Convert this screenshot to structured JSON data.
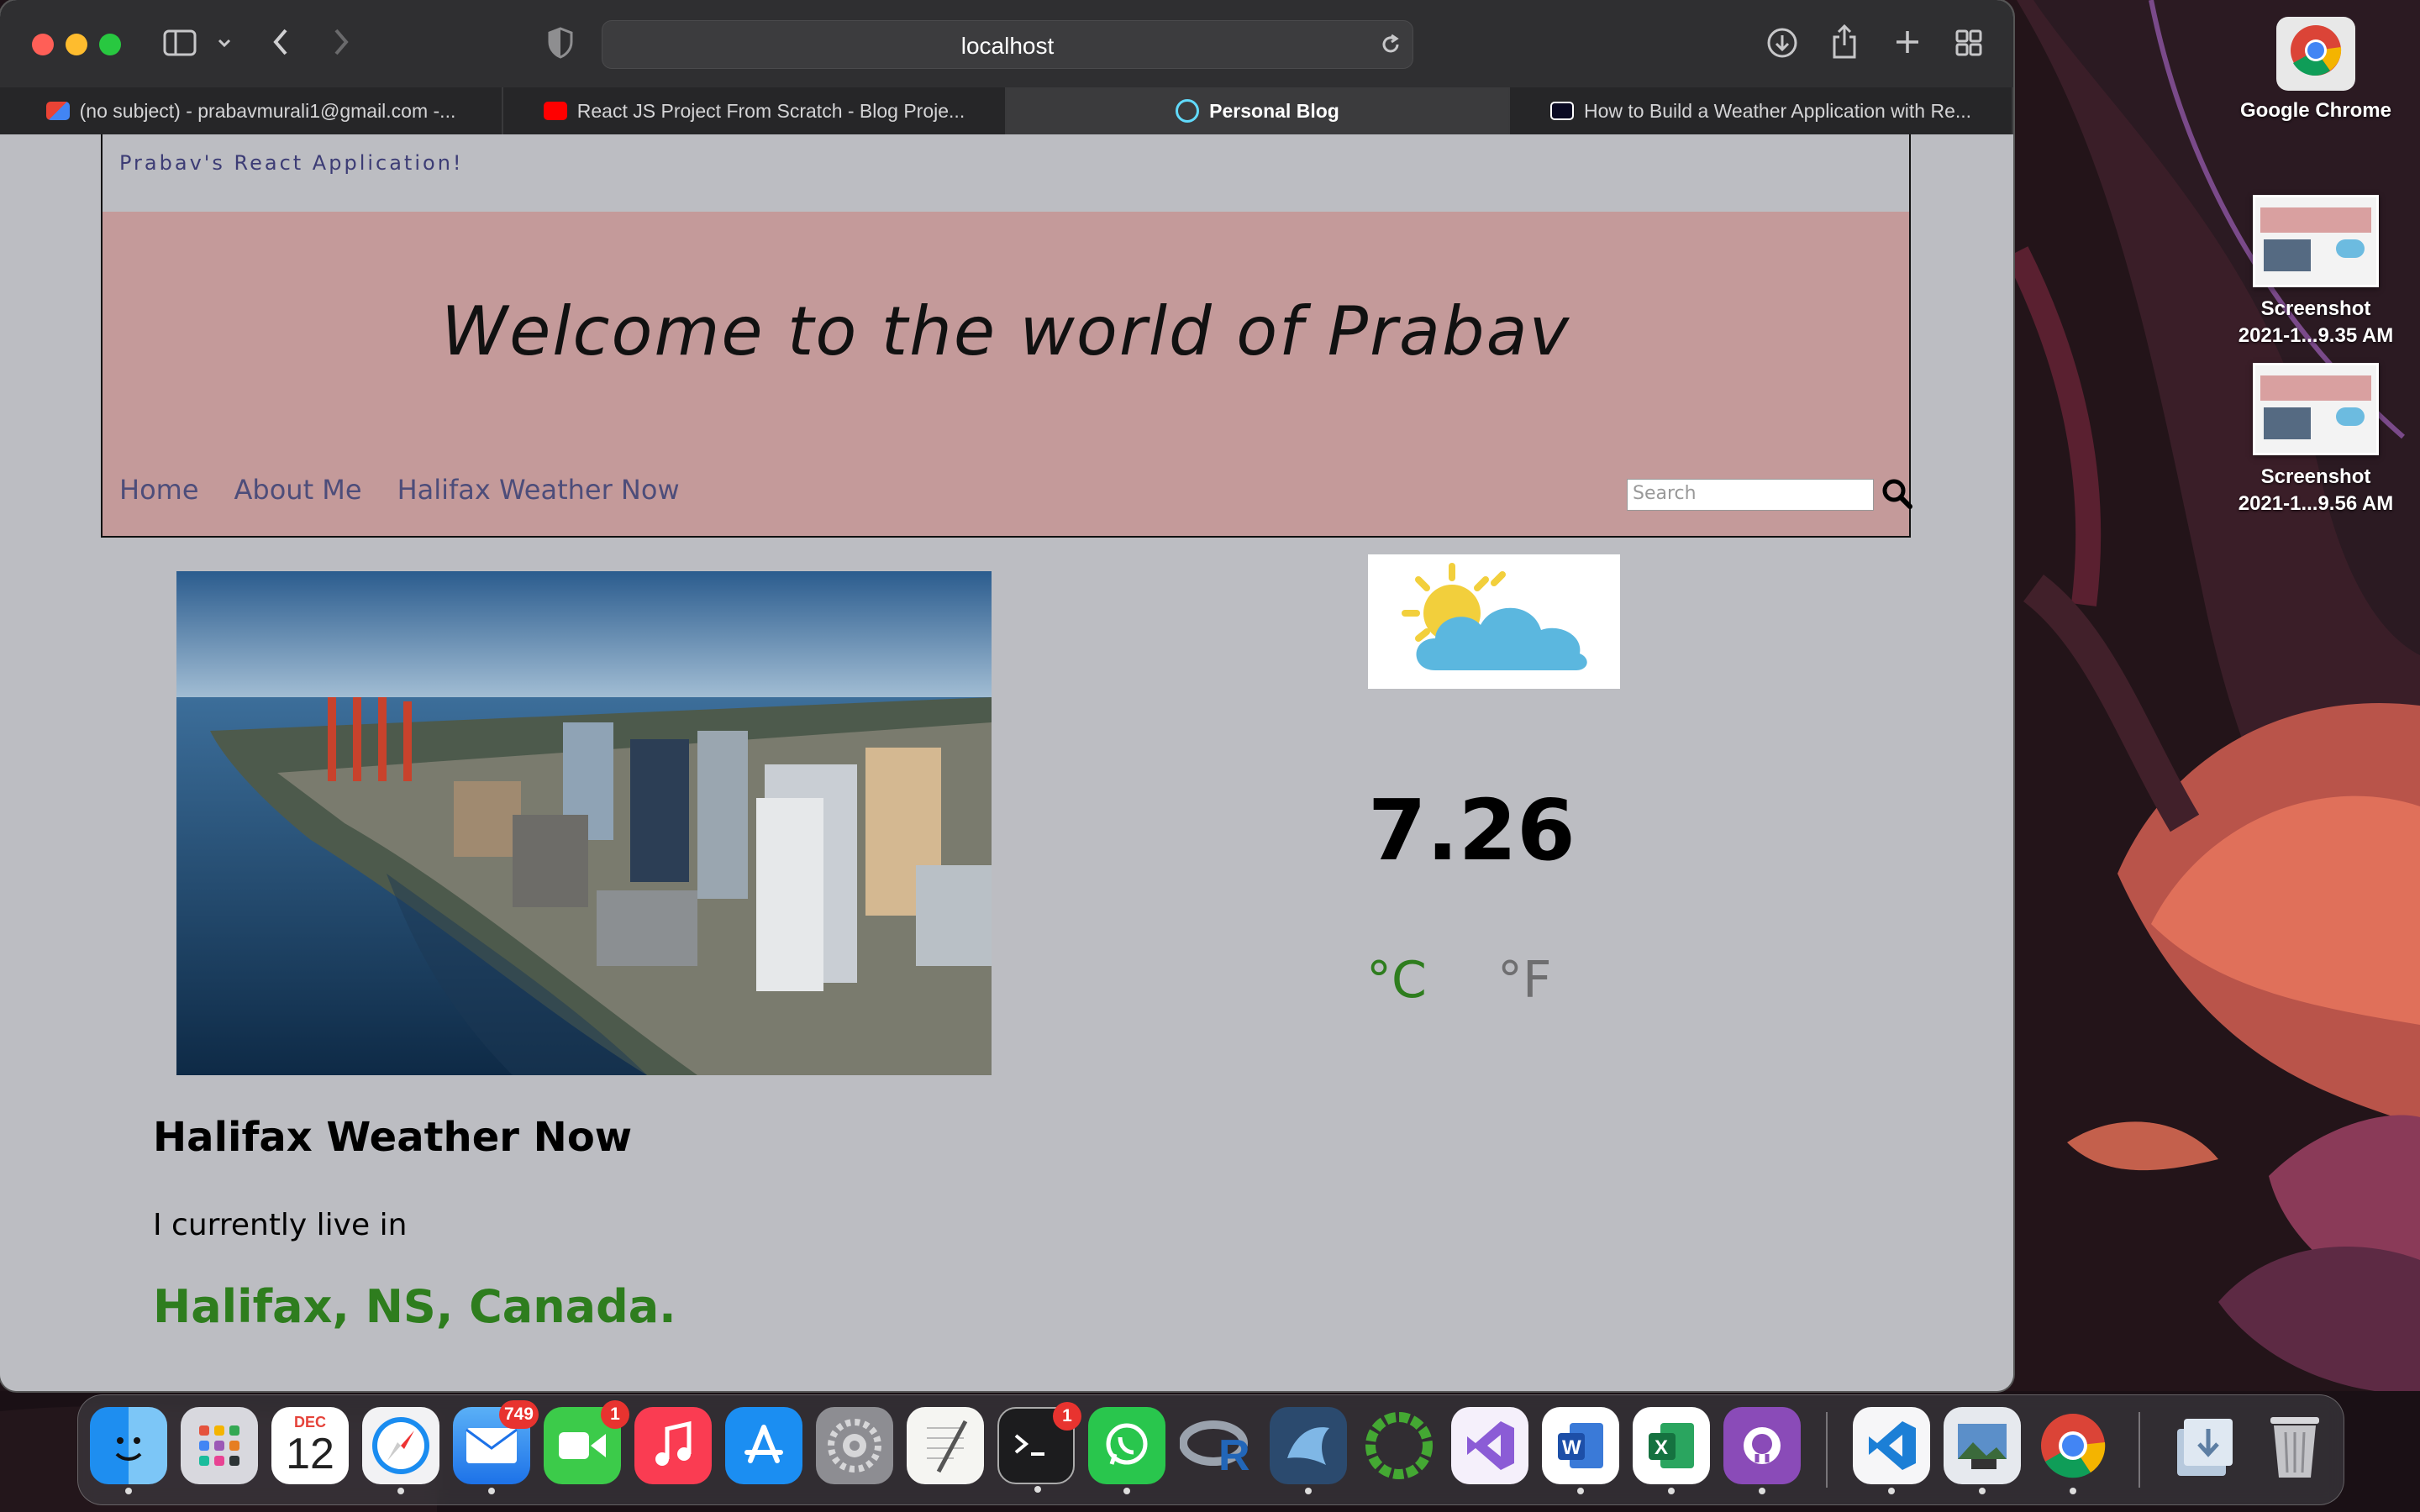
{
  "browser": {
    "url": "localhost",
    "tabs": [
      {
        "title": "(no subject) - prabavmurali1@gmail.com -...",
        "icon": "gmail-icon",
        "active": false
      },
      {
        "title": "React JS Project From Scratch - Blog Proje...",
        "icon": "youtube-icon",
        "active": false
      },
      {
        "title": "Personal Blog",
        "icon": "react-icon",
        "active": true
      },
      {
        "title": "How to Build a Weather Application with Re...",
        "icon": "freecodecamp-icon",
        "active": false
      }
    ]
  },
  "site": {
    "brand": "Prabav's React Application!",
    "hero_title": "Welcome to the world of Prabav",
    "nav": [
      "Home",
      "About Me",
      "Halifax Weather Now"
    ],
    "search_placeholder": "Search"
  },
  "weather": {
    "temperature": "7.26",
    "unit_celsius": "°C",
    "unit_fahrenheit": "°F",
    "icon": "partly-cloudy-icon",
    "heading": "Halifax Weather Now",
    "live_text": "I currently live in",
    "location": "Halifax, NS, Canada.",
    "accent_color": "#2e7d1e"
  },
  "desktop": {
    "items": [
      {
        "label": "Google Chrome"
      },
      {
        "label_line1": "Screenshot",
        "label_line2": "2021-1...9.35 AM"
      },
      {
        "label_line1": "Screenshot",
        "label_line2": "2021-1...9.56 AM"
      }
    ]
  },
  "dock": {
    "calendar_month": "DEC",
    "calendar_day": "12",
    "mail_badge": "749",
    "facetime_badge": "1",
    "terminal_badge": "1",
    "apps": [
      "Finder",
      "Launchpad",
      "Calendar",
      "Safari",
      "Mail",
      "FaceTime",
      "Music",
      "App Store",
      "System Preferences",
      "TextEdit",
      "Terminal",
      "WhatsApp",
      "R",
      "MySQL Workbench",
      "Anaconda",
      "Visual Studio",
      "Word",
      "Excel",
      "GitHub Desktop",
      "VS Code",
      "Preview",
      "Google Chrome",
      "Downloads",
      "Trash"
    ]
  }
}
